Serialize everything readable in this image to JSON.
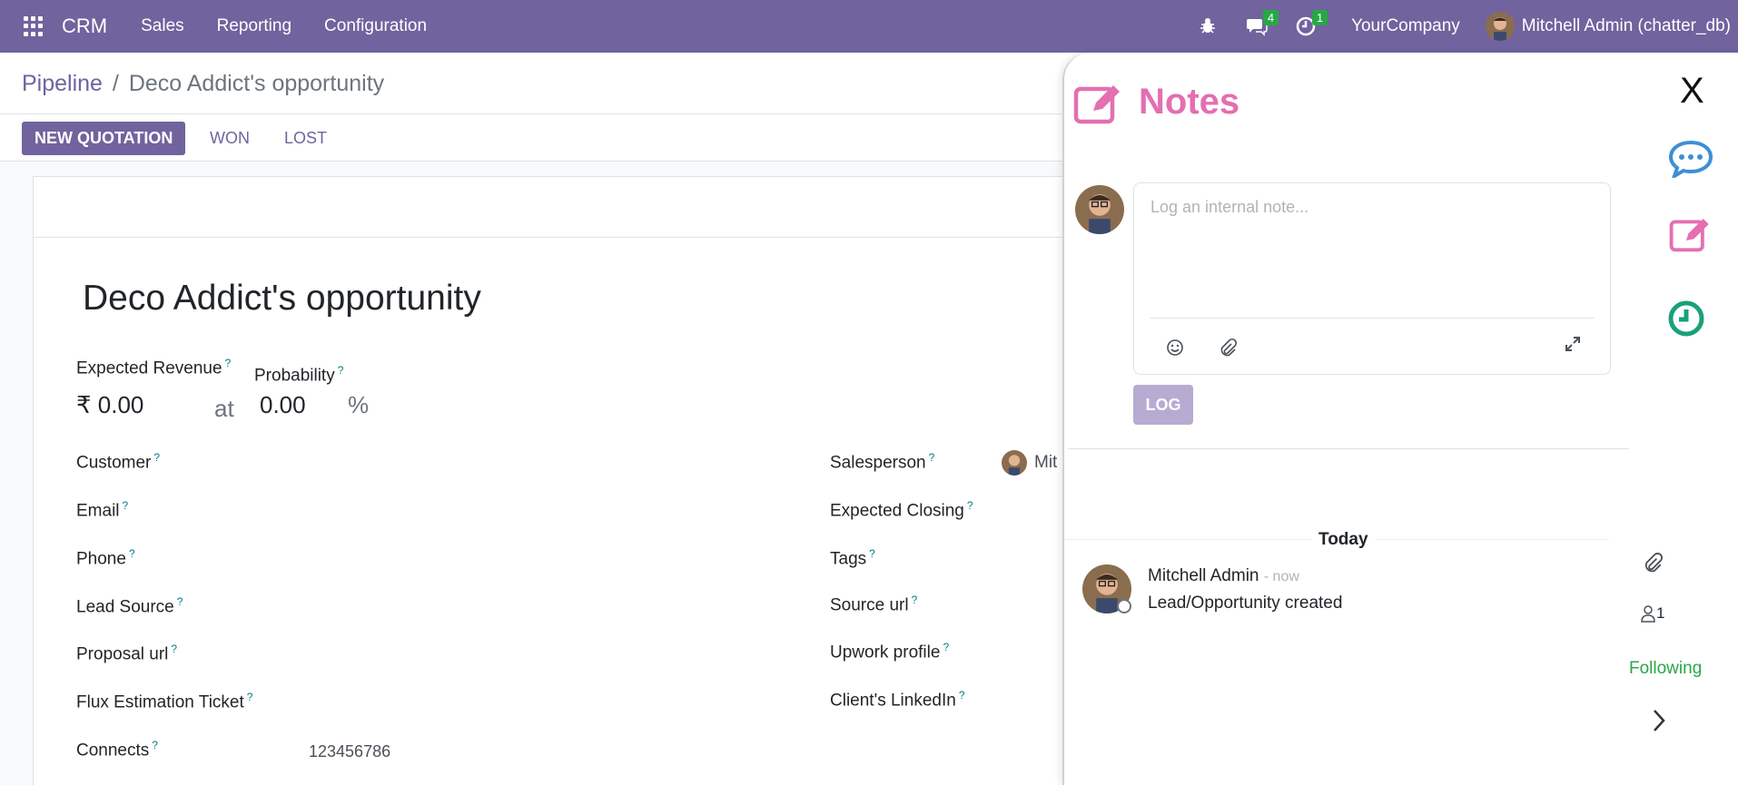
{
  "navbar": {
    "app_name": "CRM",
    "menu": [
      "Sales",
      "Reporting",
      "Configuration"
    ],
    "messages_count": "4",
    "activities_count": "1",
    "company": "YourCompany",
    "user": "Mitchell Admin (chatter_db)",
    "accent_color": "#71639e"
  },
  "breadcrumb": {
    "parent": "Pipeline",
    "separator": "/",
    "current": "Deco Addict's opportunity"
  },
  "statusbar": {
    "new_quotation": "NEW QUOTATION",
    "won": "WON",
    "lost": "LOST"
  },
  "form": {
    "title": "Deco Addict's opportunity",
    "expected_revenue_label": "Expected Revenue",
    "expected_revenue": "₹ 0.00",
    "at": "at",
    "probability_label": "Probability",
    "probability": "0.00",
    "percent": "%",
    "help": "?",
    "left_fields": [
      "Customer",
      "Email",
      "Phone",
      "Lead Source",
      "Proposal url",
      "Flux Estimation Ticket",
      "Connects"
    ],
    "connects_value": "123456786",
    "right_fields": [
      "Salesperson",
      "Expected Closing",
      "Tags",
      "Source url",
      "Upwork profile",
      "Client's LinkedIn"
    ],
    "salesperson_value": "Mit"
  },
  "chatter": {
    "title": "Notes",
    "close": "X",
    "placeholder": "Log an internal note...",
    "log_button": "LOG",
    "today": "Today",
    "message": {
      "author": "Mitchell Admin",
      "time": "- now",
      "body": "Lead/Opportunity created"
    },
    "followers_count": "1",
    "following": "Following",
    "notes_color": "#e46fb1",
    "message_color": "#3d8fd6",
    "activity_color": "#1aa179"
  }
}
